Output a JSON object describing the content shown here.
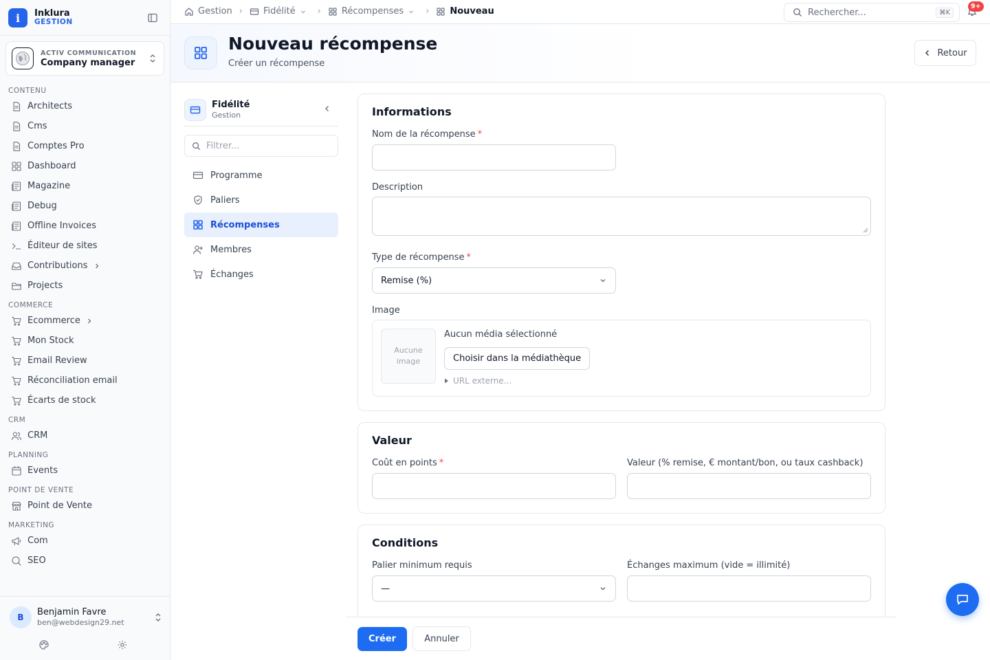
{
  "brand": {
    "name": "Inklura",
    "subtitle": "GESTION"
  },
  "org": {
    "kicker": "ACTIV COMMUNICATION",
    "name": "Company manager"
  },
  "sidebar": {
    "sections": [
      {
        "title": "CONTENU",
        "items": [
          {
            "label": "Architects",
            "icon": "file-icon"
          },
          {
            "label": "Cms",
            "icon": "file-icon"
          },
          {
            "label": "Comptes Pro",
            "icon": "file-icon"
          },
          {
            "label": "Dashboard",
            "icon": "grid-icon"
          },
          {
            "label": "Magazine",
            "icon": "newspaper-icon"
          },
          {
            "label": "Debug",
            "icon": "newspaper-icon"
          },
          {
            "label": "Offline Invoices",
            "icon": "newspaper-icon"
          },
          {
            "label": "Éditeur de sites",
            "icon": "terminal-icon"
          },
          {
            "label": "Contributions",
            "icon": "inbox-icon",
            "chevron": true
          },
          {
            "label": "Projects",
            "icon": "folder-icon"
          }
        ]
      },
      {
        "title": "COMMERCE",
        "items": [
          {
            "label": "Ecommerce",
            "icon": "cart-icon",
            "chevron": true
          },
          {
            "label": "Mon Stock",
            "icon": "cart-icon"
          },
          {
            "label": "Email Review",
            "icon": "cart-icon"
          },
          {
            "label": "Réconciliation email",
            "icon": "cart-icon"
          },
          {
            "label": "Écarts de stock",
            "icon": "cart-icon"
          }
        ]
      },
      {
        "title": "CRM",
        "items": [
          {
            "label": "CRM",
            "icon": "users-icon"
          }
        ]
      },
      {
        "title": "PLANNING",
        "items": [
          {
            "label": "Events",
            "icon": "calendar-icon"
          }
        ]
      },
      {
        "title": "POINT DE VENTE",
        "items": [
          {
            "label": "Point de Vente",
            "icon": "store-icon"
          }
        ]
      },
      {
        "title": "MARKETING",
        "items": [
          {
            "label": "Com",
            "icon": "megaphone-icon"
          },
          {
            "label": "SEO",
            "icon": "search-icon"
          }
        ]
      }
    ]
  },
  "user": {
    "initial": "B",
    "name": "Benjamin Favre",
    "email": "ben@webdesign29.net"
  },
  "breadcrumbs": {
    "home": "Gestion",
    "module": "Fidélité",
    "section": "Récompenses",
    "current": "Nouveau"
  },
  "search": {
    "placeholder": "Rechercher...",
    "shortcut": "⌘K"
  },
  "notifications": {
    "badge": "9+"
  },
  "page": {
    "title": "Nouveau récompense",
    "subtitle": "Créer un récompense",
    "back_label": "Retour"
  },
  "module_nav": {
    "title": "Fidélité",
    "subtitle": "Gestion",
    "filter_placeholder": "Filtrer...",
    "items": [
      {
        "label": "Programme",
        "icon": "card-icon",
        "active": false
      },
      {
        "label": "Paliers",
        "icon": "shield-icon",
        "active": false
      },
      {
        "label": "Récompenses",
        "icon": "grid-icon",
        "active": true
      },
      {
        "label": "Membres",
        "icon": "user-plus-icon",
        "active": false
      },
      {
        "label": "Échanges",
        "icon": "cart-icon",
        "active": false
      }
    ]
  },
  "form": {
    "informations": {
      "title": "Informations",
      "name_label": "Nom de la récompense",
      "description_label": "Description",
      "type_label": "Type de récompense",
      "type_value": "Remise (%)",
      "image_label": "Image",
      "no_image": "Aucune image",
      "no_media": "Aucun média sélectionné",
      "choose_media": "Choisir dans la médiathèque",
      "external_url": "URL externe..."
    },
    "valeur": {
      "title": "Valeur",
      "cost_label": "Coût en points",
      "value_label": "Valeur (% remise, € montant/bon, ou taux cashback)"
    },
    "conditions": {
      "title": "Conditions",
      "min_tier_label": "Palier minimum requis",
      "min_tier_value": "—",
      "max_exchanges_label": "Échanges maximum (vide = illimité)"
    }
  },
  "actions": {
    "create": "Créer",
    "cancel": "Annuler"
  },
  "colors": {
    "accent": "#1d6cf2",
    "required": "#ef4444",
    "badge": "#ef4444"
  }
}
